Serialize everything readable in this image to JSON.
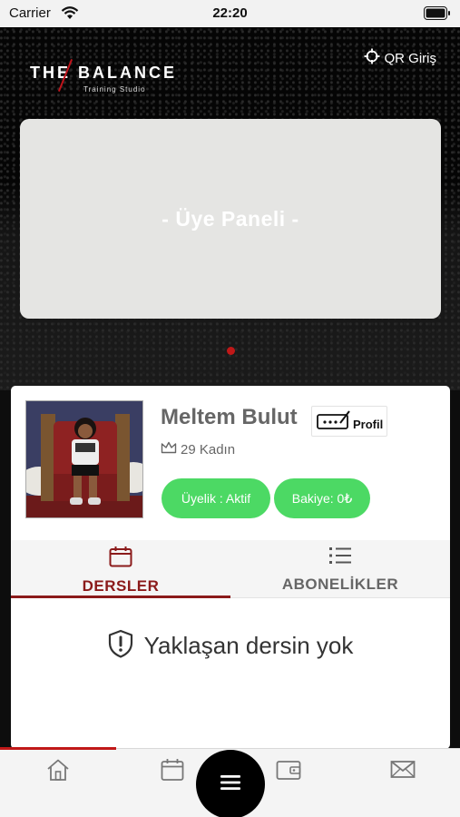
{
  "status_bar": {
    "carrier": "Carrier",
    "time": "22:20"
  },
  "header": {
    "logo_title": "THE BALANCE",
    "logo_subtitle": "Training Studio",
    "qr_login_label": "QR Giriş"
  },
  "banner": {
    "text": "- Üye Paneli -"
  },
  "carousel": {
    "pages": 1,
    "active_index": 0
  },
  "profile": {
    "name": "Meltem Bulut",
    "profile_button_label": "Profil",
    "info": "29 Kadın",
    "membership_label": "Üyelik : Aktif",
    "balance_label": "Bakiye: 0₺"
  },
  "tabs": [
    {
      "label": "DERSLER",
      "icon": "calendar-icon",
      "active": true
    },
    {
      "label": "ABONELİKLER",
      "icon": "list-icon",
      "active": false
    }
  ],
  "empty_state": {
    "text": "Yaklaşan dersin yok",
    "icon": "shield-alert-icon"
  },
  "bottom_nav": {
    "items": [
      "home-icon",
      "calendar-icon",
      "menu-icon",
      "wallet-icon",
      "mail-icon"
    ],
    "active_index": 0
  },
  "colors": {
    "accent_red": "#c01818",
    "tab_active": "#8b1a1a",
    "badge_green": "#4cd964"
  }
}
